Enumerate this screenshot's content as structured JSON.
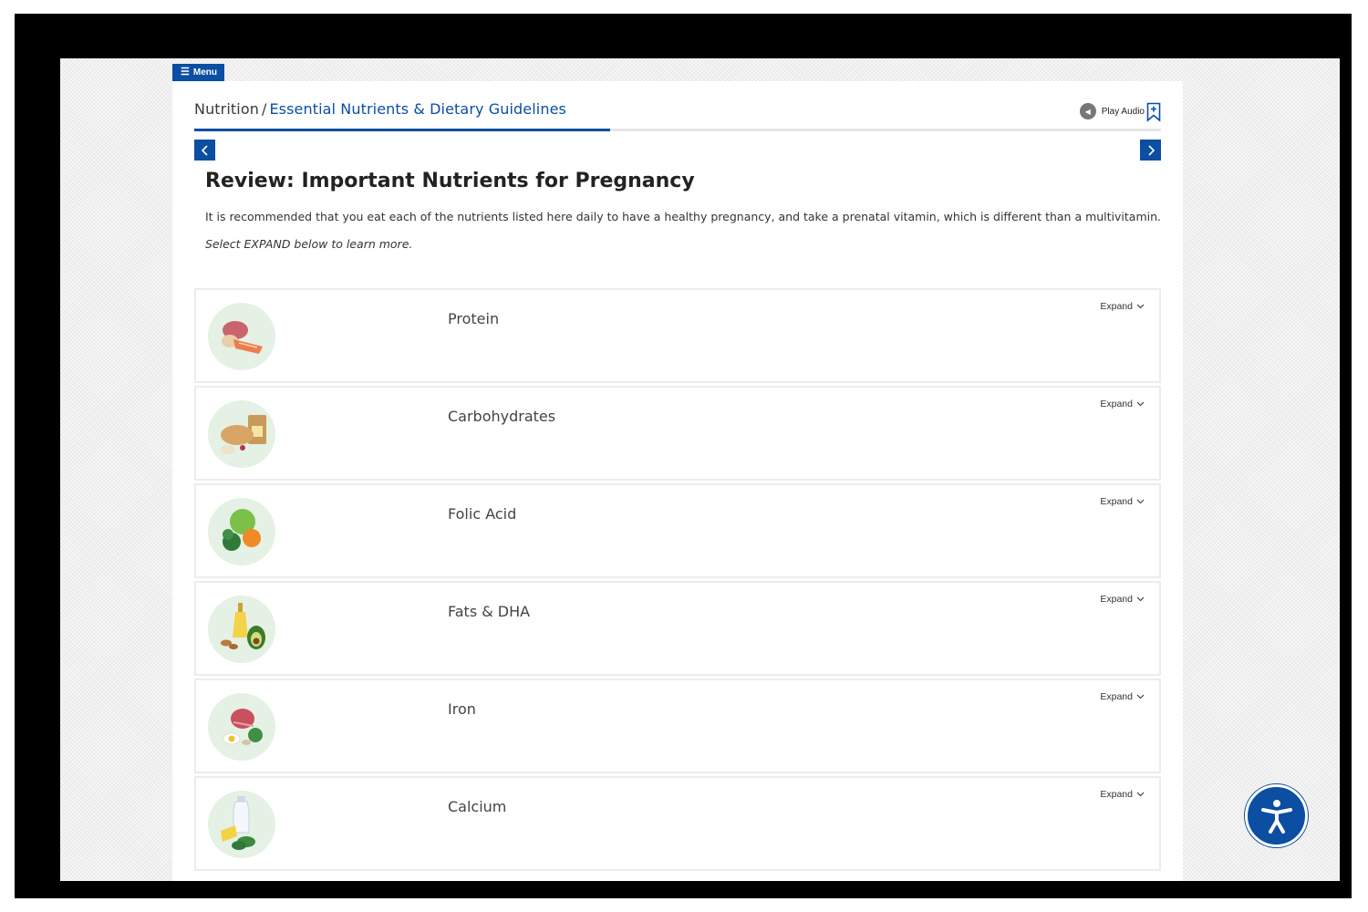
{
  "menu": {
    "label": "Menu"
  },
  "breadcrumb": {
    "parent": "Nutrition",
    "separator": "/",
    "current": "Essential Nutrients & Dietary Guidelines"
  },
  "progress": {
    "fraction": 0.43
  },
  "audio": {
    "label": "Play Audio",
    "icon": "speaker-icon"
  },
  "page": {
    "title": "Review: Important Nutrients for Pregnancy",
    "intro": "It is recommended that you eat each of the nutrients listed here daily to have a healthy pregnancy, and take a prenatal vitamin, which is different than a multivitamin.",
    "hint": "Select EXPAND below to learn more."
  },
  "items": [
    {
      "label": "Protein",
      "expand": "Expand",
      "icon": "protein-foods-icon"
    },
    {
      "label": "Carbohydrates",
      "expand": "Expand",
      "icon": "carbohydrates-foods-icon"
    },
    {
      "label": "Folic Acid",
      "expand": "Expand",
      "icon": "folic-acid-foods-icon"
    },
    {
      "label": "Fats & DHA",
      "expand": "Expand",
      "icon": "fats-dha-foods-icon"
    },
    {
      "label": "Iron",
      "expand": "Expand",
      "icon": "iron-foods-icon"
    },
    {
      "label": "Calcium",
      "expand": "Expand",
      "icon": "calcium-foods-icon"
    }
  ],
  "colors": {
    "accent": "#0b4ea2",
    "thumb_bg": "#e4f1e4"
  }
}
